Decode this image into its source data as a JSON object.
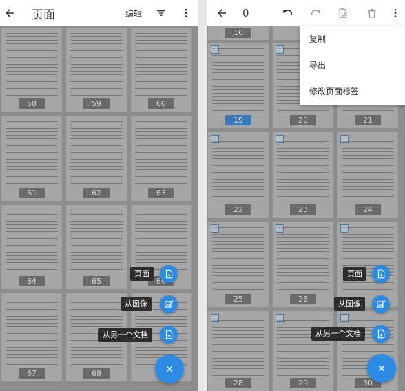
{
  "left_screen": {
    "title": "页面",
    "edit_label": "编辑",
    "pages": [
      "58",
      "59",
      "60",
      "61",
      "62",
      "63",
      "64",
      "65",
      "66",
      "67",
      "68",
      ""
    ],
    "fab_menu": {
      "pages_label": "页面",
      "from_image_label": "从图像",
      "from_doc_label": "从另一个文档"
    }
  },
  "right_screen": {
    "selected_count": "0",
    "pages": [
      "16",
      "",
      "",
      "19",
      "20",
      "21",
      "22",
      "23",
      "24",
      "25",
      "26",
      "",
      "28",
      "29",
      "30"
    ],
    "selected_page": "19",
    "overflow_menu": {
      "copy": "复制",
      "export": "导出",
      "modify_label": "修改页面标签"
    },
    "fab_menu": {
      "pages_label": "页面",
      "from_image_label": "从图像",
      "from_doc_label": "从另一个文档"
    }
  },
  "colors": {
    "accent": "#2e8be4",
    "selection": "#3a79b8",
    "scrim": "#8d8d8d"
  },
  "icons": [
    "arrow-back-icon",
    "filter-icon",
    "more-vert-icon",
    "undo-icon",
    "redo-icon",
    "page-rotate-icon",
    "delete-icon",
    "add-page-icon",
    "add-image-icon",
    "close-icon"
  ]
}
